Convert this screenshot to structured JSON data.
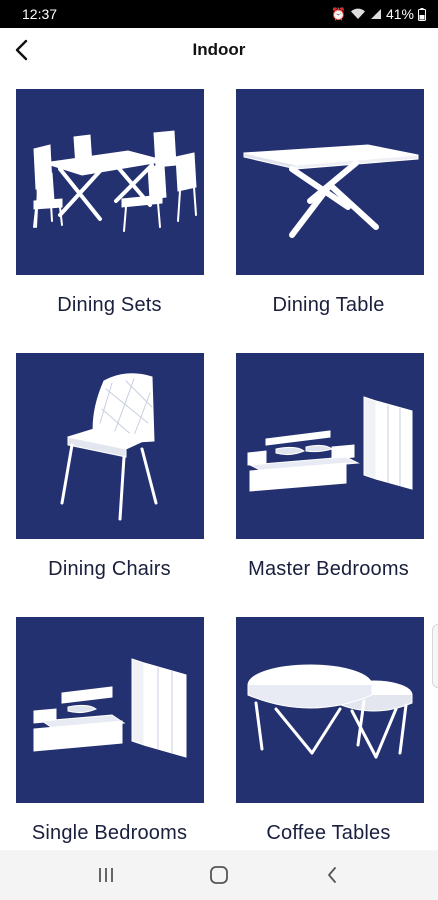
{
  "status_bar": {
    "time": "12:37",
    "battery": "41%",
    "icons": [
      "alarm-icon",
      "wifi-icon",
      "signal-icon",
      "battery-icon"
    ]
  },
  "app_bar": {
    "title": "Indoor",
    "back_icon": "chevron-left-icon"
  },
  "categories": [
    {
      "label": "Dining Sets",
      "icon": "dining-set-image"
    },
    {
      "label": "Dining Table",
      "icon": "dining-table-image"
    },
    {
      "label": "Dining Chairs",
      "icon": "dining-chair-image"
    },
    {
      "label": "Master Bedrooms",
      "icon": "master-bedroom-image"
    },
    {
      "label": "Single Bedrooms",
      "icon": "single-bedroom-image"
    },
    {
      "label": "Coffee Tables",
      "icon": "coffee-table-image"
    }
  ],
  "colors": {
    "tile_background": "#243170",
    "label_text": "#1a1f3d",
    "furniture": "#ffffff"
  },
  "nav_bar": {
    "buttons": [
      "recent-apps-icon",
      "home-icon",
      "back-icon"
    ]
  }
}
